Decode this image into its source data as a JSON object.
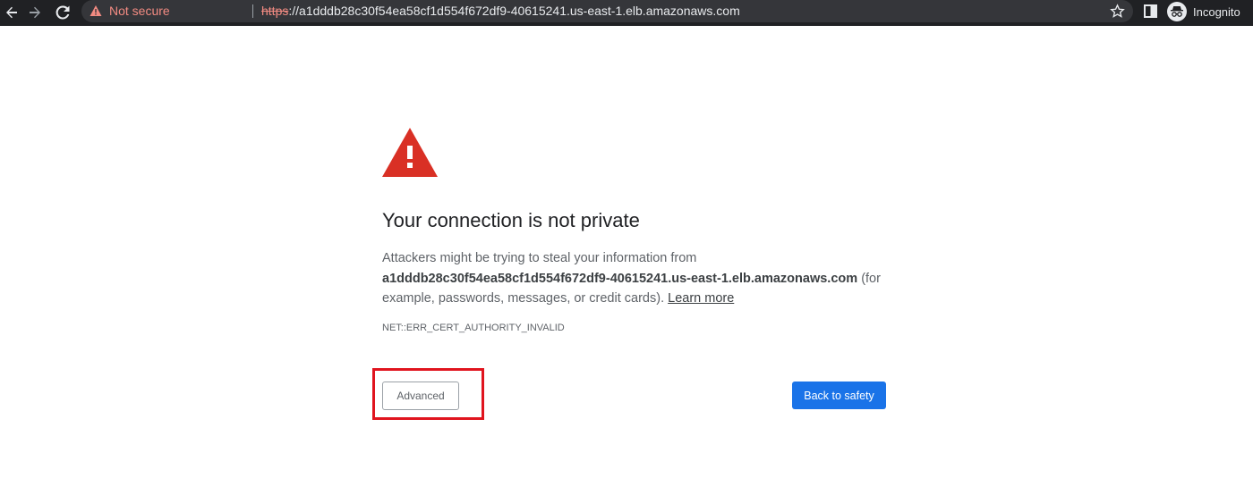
{
  "toolbar": {
    "security_label": "Not secure",
    "url_scheme": "https",
    "url_rest": "://a1dddb28c30f54ea58cf1d554f672df9-40615241.us-east-1.elb.amazonaws.com",
    "profile_label": "Incognito",
    "icons": [
      "back-icon",
      "forward-icon",
      "reload-icon",
      "warning-icon",
      "star-icon",
      "side-panel-icon",
      "incognito-icon"
    ]
  },
  "page": {
    "heading": "Your connection is not private",
    "explanation_prefix": "Attackers might be trying to steal your information from",
    "host": "a1dddb28c30f54ea58cf1d554f672df9-40615241.us-east-1.elb.amazonaws.com",
    "explanation_suffix": "(for example, passwords, messages, or credit cards).",
    "learn_more": "Learn more",
    "error_code": "NET::ERR_CERT_AUTHORITY_INVALID",
    "advanced_label": "Advanced",
    "back_label": "Back to safety"
  },
  "colors": {
    "toolbar_bg": "#202124",
    "omnibox_bg": "#35363a",
    "warning_red": "#f28b82",
    "error_icon_red": "#d93025",
    "primary_button": "#1a73e8",
    "highlight_box": "#e0141e"
  }
}
